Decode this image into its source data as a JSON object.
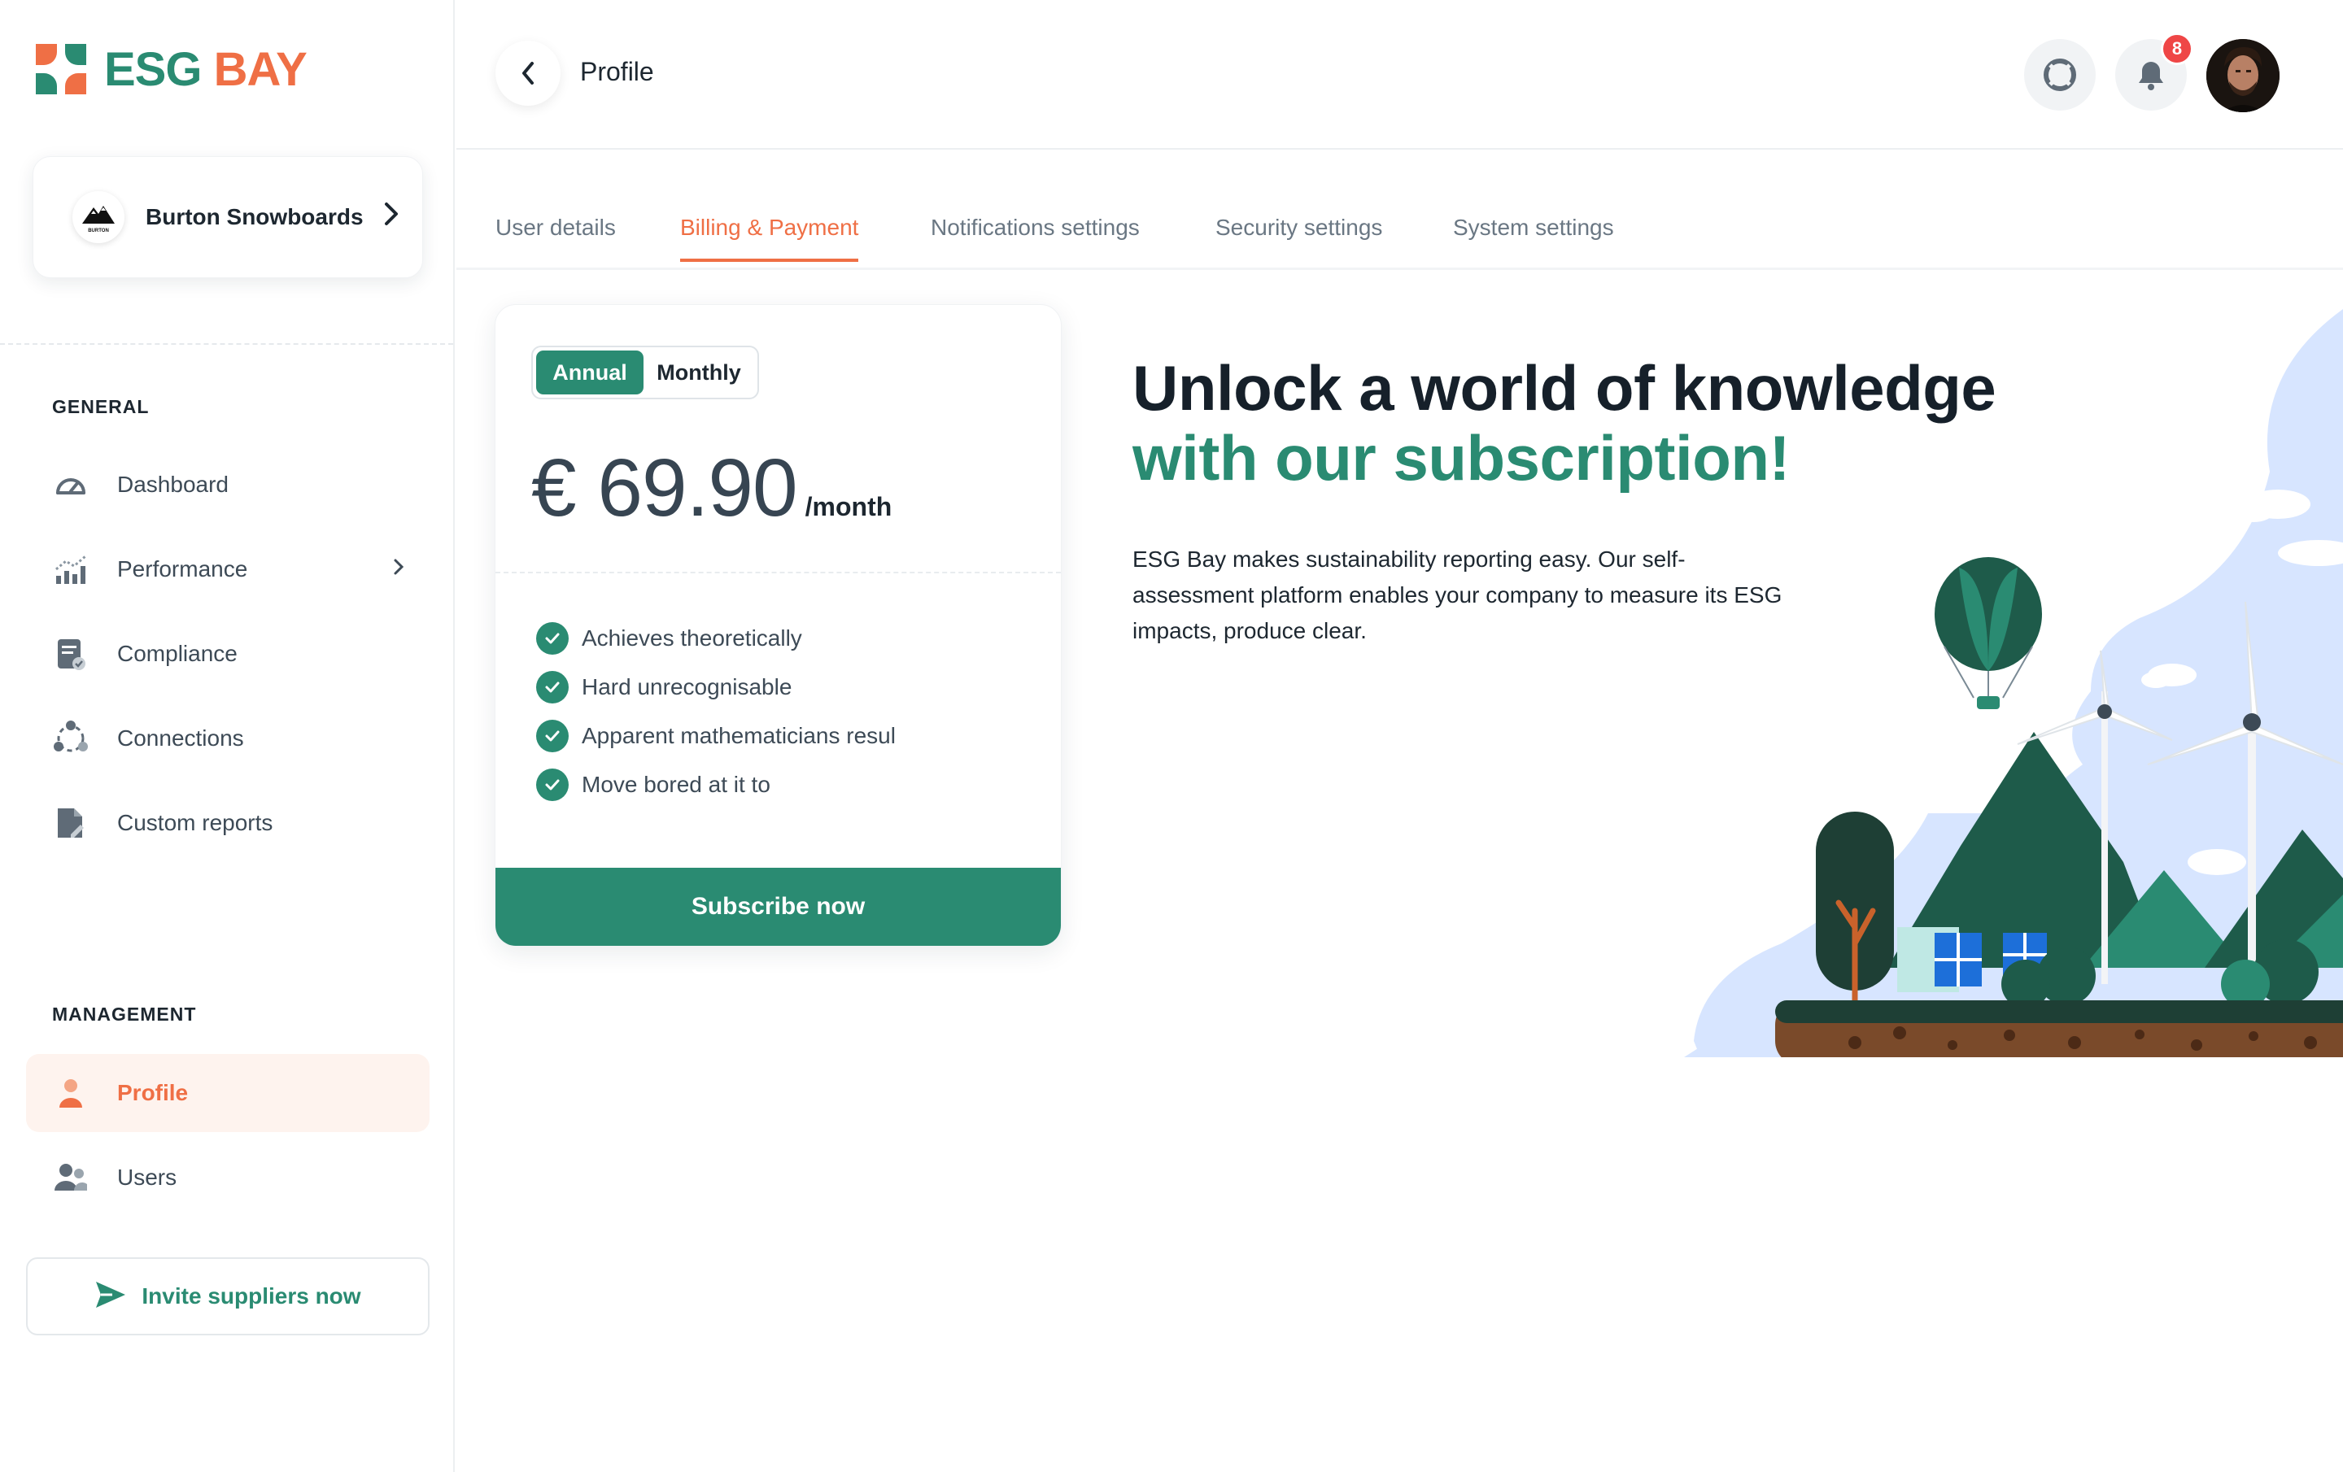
{
  "brand": {
    "esg": "ESG",
    "bay": "BAY"
  },
  "company": {
    "name": "Burton Snowboards",
    "logo_text": "BURTON"
  },
  "sidebar": {
    "general_label": "GENERAL",
    "general_items": [
      {
        "label": "Dashboard",
        "icon": "gauge-icon"
      },
      {
        "label": "Performance",
        "icon": "bar-chart-icon"
      },
      {
        "label": "Compliance",
        "icon": "document-check-icon"
      },
      {
        "label": "Connections",
        "icon": "connections-icon"
      },
      {
        "label": "Custom reports",
        "icon": "report-icon"
      }
    ],
    "management_label": "MANAGEMENT",
    "management_items": [
      {
        "label": "Profile",
        "icon": "user-icon",
        "active": true
      },
      {
        "label": "Users",
        "icon": "users-icon"
      }
    ],
    "invite_label": "Invite suppliers now"
  },
  "header": {
    "title": "Profile",
    "notification_count": "8"
  },
  "tabs": [
    {
      "label": "User details"
    },
    {
      "label": "Billing & Payment",
      "active": true
    },
    {
      "label": "Notifications settings"
    },
    {
      "label": "Security settings"
    },
    {
      "label": "System settings"
    }
  ],
  "pricing": {
    "toggle": {
      "annual": "Annual",
      "monthly": "Monthly",
      "selected": "Annual"
    },
    "price": "€ 69.90",
    "period": "/month",
    "features": [
      "Achieves theoretically",
      "Hard unrecognisable",
      "Apparent mathematicians resul",
      "Move bored at it to"
    ],
    "subscribe_label": "Subscribe now"
  },
  "promo": {
    "title_line1": "Unlock a world of knowledge",
    "title_line2": "with our subscription!",
    "desc_line1": "ESG Bay makes sustainability reporting easy. Our self-",
    "desc_line2": "assessment platform enables your company to measure its ESG",
    "desc_line3": "impacts, produce clear."
  },
  "colors": {
    "brand_green": "#2a8b72",
    "brand_orange": "#ef6f45",
    "badge_red": "#ef4646"
  }
}
